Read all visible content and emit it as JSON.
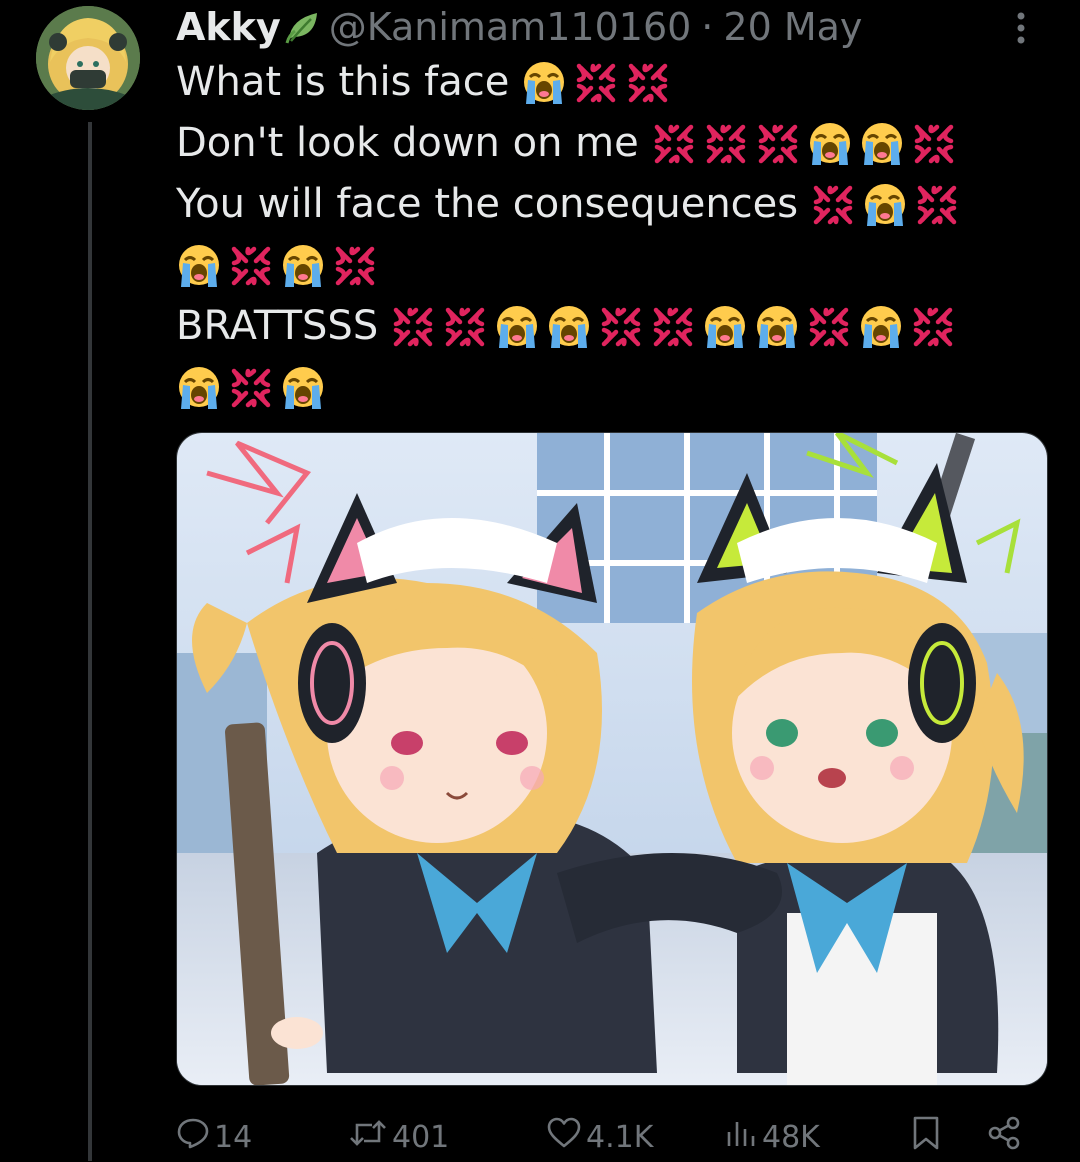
{
  "tweet": {
    "author": {
      "display_name": "Akky",
      "handle": "@Kanimam110160",
      "separator": "·",
      "date": "20 May"
    },
    "lines": [
      {
        "text": "What is this face",
        "emojis": [
          "crying",
          "anger",
          "anger"
        ]
      },
      {
        "text": "Don't look down on me",
        "emojis": [
          "anger",
          "anger",
          "anger",
          "crying",
          "crying",
          "anger"
        ]
      },
      {
        "text": "You will face the consequences",
        "emojis": [
          "anger",
          "crying",
          "anger"
        ]
      },
      {
        "text": "",
        "emojis": [
          "crying",
          "anger",
          "crying",
          "anger"
        ]
      },
      {
        "text": "BRATTSSS",
        "emojis": [
          "anger",
          "anger",
          "crying",
          "crying",
          "anger",
          "anger",
          "crying",
          "crying",
          "anger",
          "crying",
          "anger"
        ]
      },
      {
        "text": "",
        "emojis": [
          "crying",
          "anger",
          "crying"
        ]
      }
    ],
    "media": {
      "kind": "anime illustration: two blonde maid twins with cat-ear headphones"
    },
    "metrics": {
      "replies": "14",
      "reposts": "401",
      "likes": "4.1K",
      "views": "48K"
    }
  },
  "colors": {
    "background": "#000000",
    "text": "#e7e9ea",
    "muted": "#71767b",
    "thread_line": "#333639",
    "anger_emoji": "#e0245e",
    "crying_emoji_face": "#ffcc4d",
    "tears": "#5dadec"
  },
  "icons": {
    "verified": "leaf-icon",
    "more": "more-vertical-icon",
    "reply": "reply-icon",
    "repost": "repost-icon",
    "like": "heart-icon",
    "views": "views-icon",
    "bookmark": "bookmark-icon",
    "share": "share-icon"
  }
}
